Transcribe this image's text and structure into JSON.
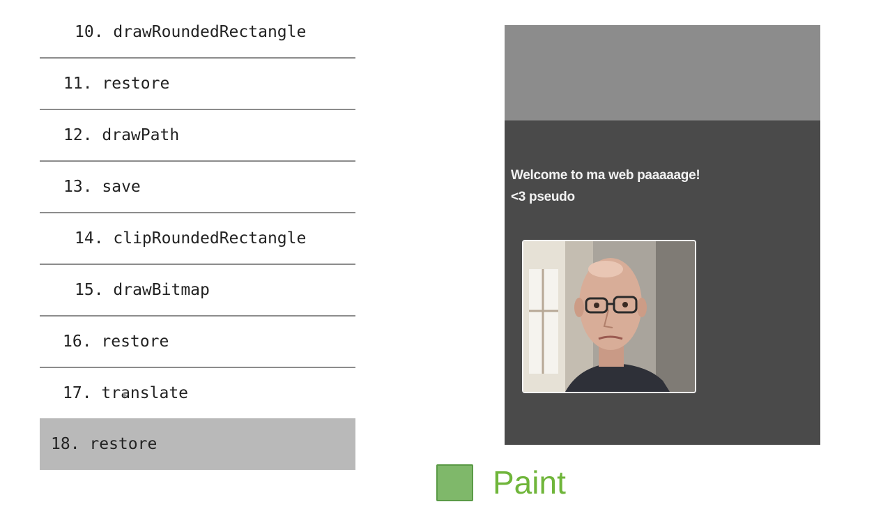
{
  "commands": [
    {
      "label": "10. drawRoundedRectangle",
      "selected": false
    },
    {
      "label": "11. restore",
      "selected": false
    },
    {
      "label": "12. drawPath",
      "selected": false
    },
    {
      "label": "13. save",
      "selected": false
    },
    {
      "label": "14. clipRoundedRectangle",
      "selected": false
    },
    {
      "label": "15. drawBitmap",
      "selected": false
    },
    {
      "label": "16. restore",
      "selected": false
    },
    {
      "label": "17. translate",
      "selected": false
    },
    {
      "label": "18. restore",
      "selected": true
    }
  ],
  "preview": {
    "line1": "Welcome to ma web paaaaage!",
    "line2": "<3 pseudo",
    "photo_icon": "person-photo"
  },
  "legend": {
    "label": "Paint",
    "color": "#7fb86a",
    "text_color": "#6fb53a"
  },
  "colors": {
    "selected_row": "#b9b9b9",
    "preview_header": "#8c8c8c",
    "preview_body": "#4a4a4a"
  }
}
